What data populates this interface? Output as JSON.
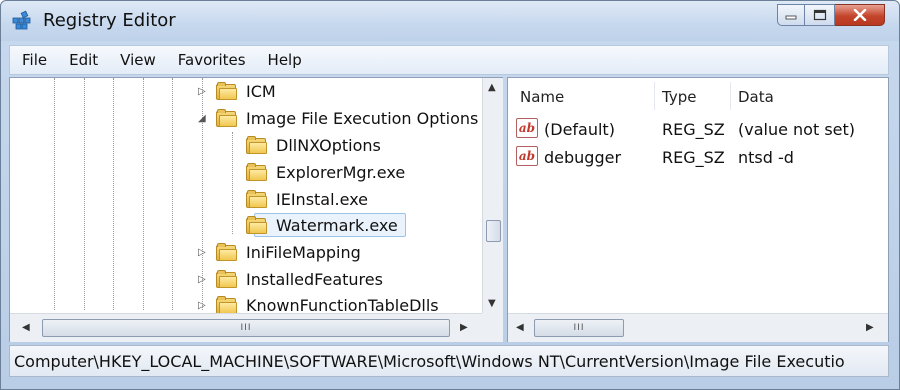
{
  "window": {
    "title": "Registry Editor",
    "app_icon": "registry-editor-icon"
  },
  "menu": [
    "File",
    "Edit",
    "View",
    "Favorites",
    "Help"
  ],
  "tree": {
    "nodes": [
      {
        "label": "ICM",
        "expander": "▷"
      },
      {
        "label": "Image File Execution Options",
        "expander": "◢"
      },
      {
        "label": "DllNXOptions",
        "expander": ""
      },
      {
        "label": "ExplorerMgr.exe",
        "expander": ""
      },
      {
        "label": "IEInstal.exe",
        "expander": ""
      },
      {
        "label": "Watermark.exe",
        "expander": "",
        "selected": true
      },
      {
        "label": "IniFileMapping",
        "expander": "▷"
      },
      {
        "label": "InstalledFeatures",
        "expander": "▷"
      },
      {
        "label": "KnownFunctionTableDlls",
        "expander": "▷"
      }
    ],
    "hscroll_grip": "III"
  },
  "list": {
    "headers": {
      "name": "Name",
      "type": "Type",
      "data": "Data"
    },
    "rows": [
      {
        "icon": "ab",
        "name": "(Default)",
        "type": "REG_SZ",
        "data": "(value not set)"
      },
      {
        "icon": "ab",
        "name": "debugger",
        "type": "REG_SZ",
        "data": "ntsd -d"
      }
    ],
    "hscroll_grip": "III"
  },
  "status": {
    "path": "Computer\\HKEY_LOCAL_MACHINE\\SOFTWARE\\Microsoft\\Windows NT\\CurrentVersion\\Image File Executio"
  },
  "colors": {
    "accent": "#c4452c",
    "frame": "#c8d9ee",
    "selection": "#eaf3fc"
  }
}
